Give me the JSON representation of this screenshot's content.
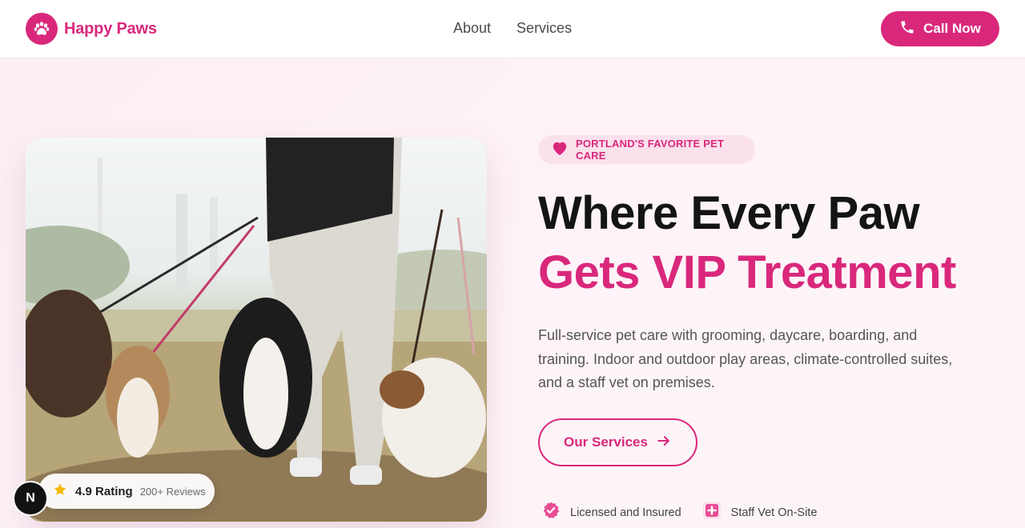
{
  "brand": {
    "name": "Happy Paws",
    "icon": "paw-icon",
    "accent_color": "#d9287c"
  },
  "nav": {
    "items": [
      {
        "label": "About"
      },
      {
        "label": "Services"
      }
    ]
  },
  "header": {
    "call_label": "Call Now",
    "call_icon": "phone-icon"
  },
  "hero": {
    "tagline": "PORTLAND'S FAVORITE PET CARE",
    "tagline_icon": "heart-icon",
    "title_line_1": "Where Every Paw",
    "title_line_2": "Gets VIP Treatment",
    "description": "Full-service pet care with grooming, daycare, boarding, and training. Indoor and outdoor play areas, climate-controlled suites, and a staff vet on premises.",
    "cta_label": "Our Services",
    "cta_icon": "arrow-right-icon",
    "features": [
      {
        "label": "Licensed and Insured",
        "icon": "verified-badge-icon"
      },
      {
        "label": "Staff Vet On-Site",
        "icon": "medical-cross-icon"
      }
    ]
  },
  "photo": {
    "description_icon": "dogs-walking-photo",
    "rating": {
      "value": "4.9 Rating",
      "reviews": "200+ Reviews",
      "icon": "star-icon"
    }
  },
  "dev_badge": {
    "label": "N"
  }
}
